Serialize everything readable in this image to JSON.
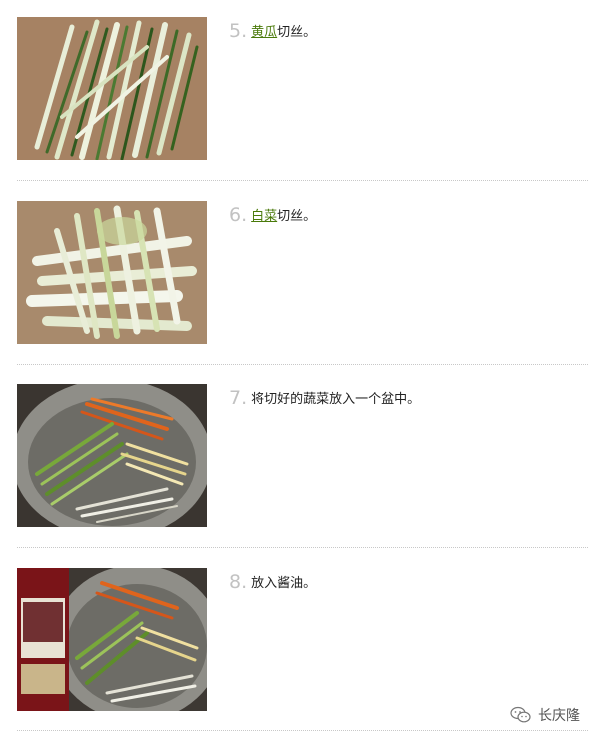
{
  "steps": [
    {
      "number": "5.",
      "link": "黄瓜",
      "rest": "切丝。"
    },
    {
      "number": "6.",
      "link": "白菜",
      "rest": "切丝。"
    },
    {
      "number": "7.",
      "link": "",
      "rest": "将切好的蔬菜放入一个盆中。"
    },
    {
      "number": "8.",
      "link": "",
      "rest": "放入酱油。"
    }
  ],
  "watermark": {
    "name": "长庆隆",
    "icon": "wechat-icon"
  },
  "colors": {
    "link": "#4a7a0a",
    "number": "#c2c2c2"
  }
}
